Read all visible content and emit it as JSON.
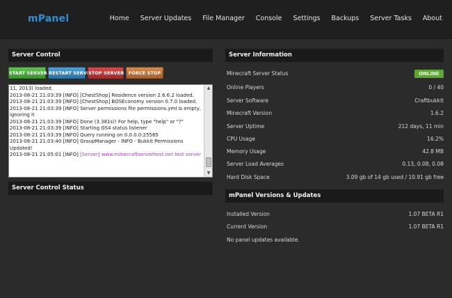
{
  "app": {
    "logo": "mPanel"
  },
  "nav": [
    "Home",
    "Server Updates",
    "File Manager",
    "Console",
    "Settings",
    "Backups",
    "Server Tasks",
    "About"
  ],
  "server_control": {
    "title": "Server Control",
    "buttons": {
      "start": "START SERVER",
      "restart": "RESTART SERVER",
      "stop": "STOP SERVER",
      "force_stop": "FORCE STOP"
    },
    "console_lines": [
      "11, 2013) loaded.",
      "2013-08-21 21:03:39 [INFO] [ChestShop] Residence version 2.6.6.2 loaded.",
      "2013-08-21 21:03:39 [INFO] [ChestShop] BOSEconomy version 0.7.0 loaded.",
      "2013-08-21 21:03:39 [INFO] Server permissions file permissions.yml is empty, ignoring it",
      "2013-08-21 21:03:39 [INFO] Done (3.381s)! For help, type \"help\" or \"?\"",
      "2013-08-21 21:03:39 [INFO] Starting GS4 status listener",
      "2013-08-21 21:03:39 [INFO] Query running on 0.0.0.0:25565",
      "2013-08-21 21:03:40 [INFO] GroupManager - INFO - Bukkit Permissions Updated!"
    ],
    "console_last_prefix": "2013-08-21 21:05:01 [INFO] ",
    "console_last_message": "[Server] www.minecraftserverhost.net test server"
  },
  "server_control_status": {
    "title": "Server Control Status"
  },
  "server_info": {
    "title": "Server Information",
    "status_label": "Minecraft Server Status",
    "status_value": "ONLINE",
    "rows": [
      {
        "label": "Online Players",
        "value": "0 / 40"
      },
      {
        "label": "Server Software",
        "value": "Craftbukkit"
      },
      {
        "label": "Minecraft Version",
        "value": "1.6.2"
      },
      {
        "label": "Server Uptime",
        "value": "212 days, 11 min"
      },
      {
        "label": "CPU Usage",
        "value": "16.2%"
      },
      {
        "label": "Memory Usage",
        "value": "42.8 MB"
      },
      {
        "label": "Server Load Averages",
        "value": "0.13, 0.08, 0.08"
      },
      {
        "label": "Hard Disk Space",
        "value": "3.09 gb of 14 gb used / 10.91 gb free"
      }
    ]
  },
  "versions": {
    "title": "mPanel Versions & Updates",
    "rows": [
      {
        "label": "Installed Version",
        "value": "1.07 BETA R1"
      },
      {
        "label": "Current Version",
        "value": "1.07 BETA R1"
      }
    ],
    "note": "No panel updates available."
  },
  "colors": {
    "accent": "#2e8fd0",
    "online": "#5aa832",
    "console_highlight": "#b13bd1"
  }
}
